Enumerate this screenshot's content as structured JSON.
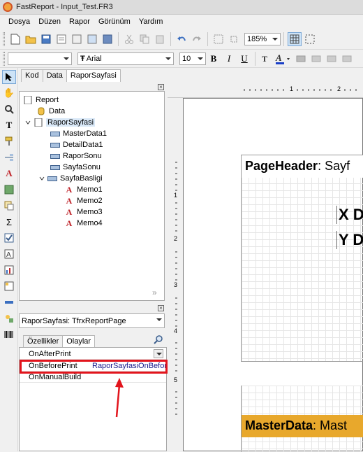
{
  "window": {
    "title": "FastReport - Input_Test.FR3"
  },
  "menu": [
    "Dosya",
    "Düzen",
    "Rapor",
    "Görünüm",
    "Yardım"
  ],
  "toolbar": {
    "zoom": "185%"
  },
  "format_toolbar": {
    "style_value": "",
    "font_name": "Arial",
    "font_size": "10",
    "bold": "B",
    "italic": "I",
    "underline": "U"
  },
  "left_tabs": [
    "Kod",
    "Data",
    "RaporSayfasi"
  ],
  "tree": {
    "items": [
      {
        "label": "Report",
        "type": "report"
      },
      {
        "label": "Data",
        "type": "data"
      },
      {
        "label": "RaporSayfasi",
        "type": "page"
      },
      {
        "label": "MasterData1",
        "type": "band"
      },
      {
        "label": "DetailData1",
        "type": "band"
      },
      {
        "label": "RaporSonu",
        "type": "band"
      },
      {
        "label": "SayfaSonu",
        "type": "band"
      },
      {
        "label": "SayfaBasligi",
        "type": "band"
      },
      {
        "label": "Memo1",
        "type": "memo"
      },
      {
        "label": "Memo2",
        "type": "memo"
      },
      {
        "label": "Memo3",
        "type": "memo"
      },
      {
        "label": "Memo4",
        "type": "memo"
      }
    ]
  },
  "inspector": {
    "object": "RaporSayfasi: TfrxReportPage",
    "tabs": [
      "Özellikler",
      "Olaylar"
    ],
    "rows": [
      {
        "name": "OnAfterPrint",
        "value": ""
      },
      {
        "name": "OnBeforePrint",
        "value": "RaporSayfasiOnBefor"
      },
      {
        "name": "OnManualBuild",
        "value": ""
      }
    ]
  },
  "ruler": {
    "h_labels": [
      "1",
      "2"
    ],
    "v_labels": [
      "1",
      "2",
      "3",
      "4",
      "5"
    ]
  },
  "design": {
    "page_header_bold": "PageHeader",
    "page_header_rest": ": Sayf",
    "memo_x": "X D",
    "memo_y": "Y D",
    "master_bold": "MasterData",
    "master_rest": ": Mast"
  },
  "colors": {
    "highlight": "#e2141c",
    "master_band": "#e8a82c",
    "accent": "#c0272d"
  }
}
